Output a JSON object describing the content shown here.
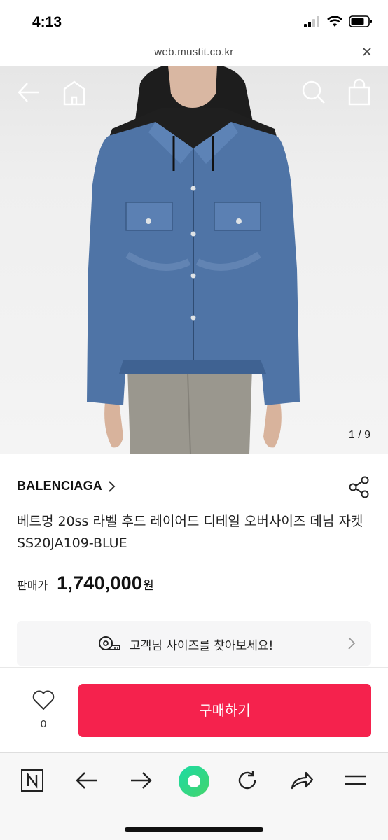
{
  "status_bar": {
    "time": "4:13"
  },
  "browser": {
    "url": "web.mustit.co.kr"
  },
  "image": {
    "counter": "1 / 9"
  },
  "product": {
    "brand": "BALENCIAGA",
    "title": "베트멍 20ss 라벨 후드 레이어드 디테일 오버사이즈 데님 자켓 SS20JA109-BLUE",
    "price_label": "판매가",
    "price": "1,740,000",
    "price_unit": "원"
  },
  "size_finder": {
    "label": "고객님 사이즈를 찾아보세요!"
  },
  "actions": {
    "like_count": "0",
    "buy_label": "구매하기"
  },
  "colors": {
    "accent": "#f5224d",
    "browser_green": "#2fd58a"
  },
  "icons": [
    "back-arrow-icon",
    "home-icon",
    "search-icon",
    "shopping-bag-icon",
    "share-icon",
    "tape-measure-icon",
    "chevron-right-icon",
    "heart-icon",
    "naver-n-icon",
    "refresh-icon",
    "menu-icon"
  ]
}
